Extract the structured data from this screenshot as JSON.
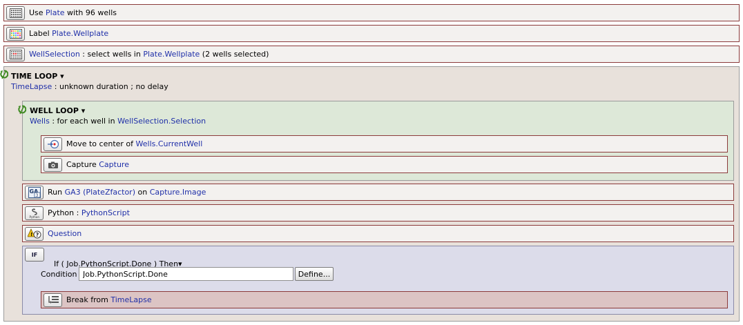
{
  "tasks": {
    "use_plate": {
      "pre": "Use ",
      "link": "Plate",
      "post": " with 96 wells",
      "icon": "well-plate-icon"
    },
    "label": {
      "pre": "Label ",
      "link": "Plate.Wellplate",
      "icon": "well-plate-label-icon"
    },
    "well_selection": {
      "link": "WellSelection",
      "mid": " : select wells in ",
      "link2": "Plate.Wellplate",
      "post": " (2 wells selected)",
      "icon": "well-selection-icon"
    }
  },
  "time_loop": {
    "title": "TIME LOOP",
    "arrow": "▾",
    "link": "TimeLapse",
    "desc": " : unknown duration ; no delay",
    "icon": "loop-icon"
  },
  "well_loop": {
    "title": "WELL LOOP",
    "arrow": "▾",
    "link": "Wells",
    "desc": " : for each well in ",
    "link2": "WellSelection.Selection",
    "icon": "loop-icon"
  },
  "move": {
    "pre": "Move to center of ",
    "link": "Wells.CurrentWell",
    "icon": "move-center-icon"
  },
  "capture": {
    "pre": "Capture ",
    "link": "Capture",
    "icon": "camera-icon"
  },
  "run_ga3": {
    "pre": "Run ",
    "link": "GA3 (PlateZfactor)",
    "mid": " on ",
    "link2": "Capture.Image",
    "icon": "ga3-icon"
  },
  "python": {
    "pre": "Python : ",
    "link": "PythonScript",
    "icon": "python-icon"
  },
  "question": {
    "link": "Question",
    "icon": "question-icon"
  },
  "if_block": {
    "badge": "IF",
    "text": "If ( Job.PythonScript.Done ) Then",
    "arrow": "▾",
    "condition_label": "Condition",
    "condition_value": "Job.PythonScript.Done",
    "define_label": "Define...",
    "break_pre": "Break from ",
    "break_link": "TimeLapse",
    "break_icon": "break-icon"
  },
  "colors": {
    "task_border": "#8b3a3a",
    "link": "#1f2fa8",
    "time_loop_bg": "#e8e1db",
    "well_loop_bg": "#dde8d8",
    "if_bg": "#dcdcea",
    "break_bg": "#dcc4c4",
    "loop_icon": "#3d8a1f"
  }
}
